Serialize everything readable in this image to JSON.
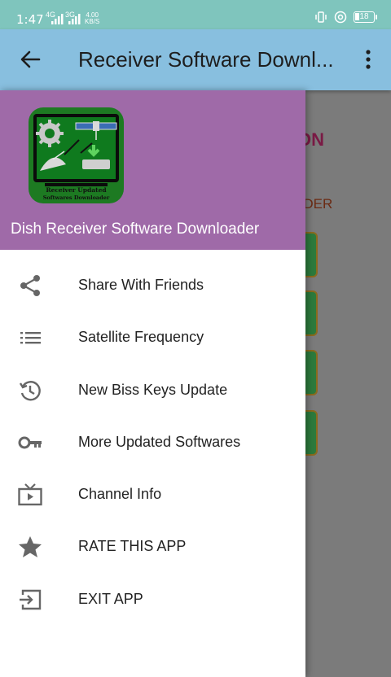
{
  "status_bar": {
    "time": "1:47",
    "network_label": "4G",
    "network_label_2": "3G",
    "speed_value": "4.00",
    "speed_unit": "KB/S",
    "battery_level": "18"
  },
  "app_bar": {
    "title": "Receiver Software Downl..."
  },
  "background": {
    "title_fragment": "ON",
    "subtitle_fragment": "ADER"
  },
  "drawer": {
    "app_name": "Dish Receiver Software Downloader",
    "logo_caption_line1": "Receiver Updated",
    "logo_caption_line2": "Softwares Downloader",
    "items": [
      {
        "label": "Share With Friends",
        "icon": "share-icon"
      },
      {
        "label": "Satellite Frequency",
        "icon": "list-icon"
      },
      {
        "label": "New Biss Keys Update",
        "icon": "history-icon"
      },
      {
        "label": "More Updated Softwares",
        "icon": "key-icon"
      },
      {
        "label": "Channel Info",
        "icon": "tv-icon"
      },
      {
        "label": "RATE THIS APP",
        "icon": "star-icon"
      },
      {
        "label": "EXIT APP",
        "icon": "exit-icon"
      }
    ]
  },
  "colors": {
    "status_bar": "#7fc5bd",
    "app_bar": "#88bfdf",
    "drawer_header": "#9f6aa8",
    "icon": "#666666"
  }
}
